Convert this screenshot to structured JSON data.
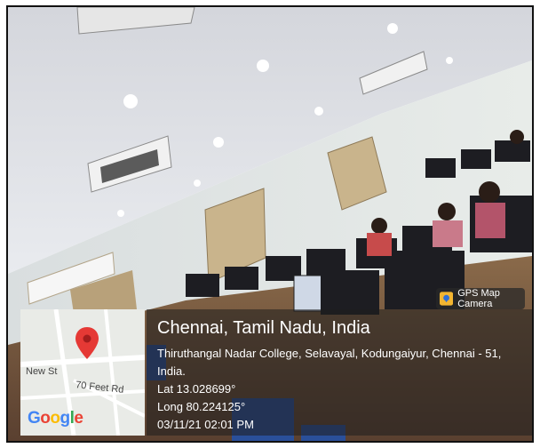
{
  "badge": {
    "label": "GPS Map Camera",
    "icon": "gps-map-camera-icon"
  },
  "map": {
    "street_1": "New St",
    "street_2": "70 Feet Rd",
    "logo": "Google",
    "pin_icon": "map-pin-icon",
    "pin_color": "#e53935"
  },
  "location": {
    "city": "Chennai, Tamil Nadu, India",
    "address_line_1": "Thiruthangal Nadar College, Selavayal, Kodungaiyur, Chennai - 51,",
    "address_line_2": "India.",
    "latitude": "Lat 13.028699°",
    "longitude": "Long 80.224125°",
    "datetime": "03/11/21 02:01 PM"
  }
}
